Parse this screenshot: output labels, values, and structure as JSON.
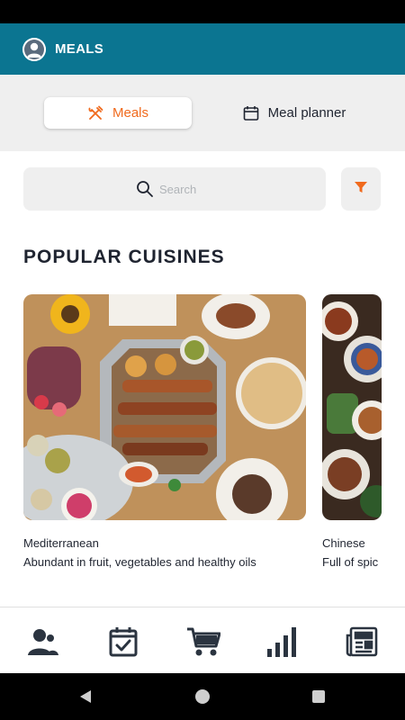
{
  "header": {
    "title": "MEALS",
    "avatar_icon": "user-avatar-icon"
  },
  "tabs": [
    {
      "label": "Meals",
      "icon": "fork-knife-icon",
      "active": true
    },
    {
      "label": "Meal planner",
      "icon": "calendar-icon",
      "active": false
    }
  ],
  "search": {
    "placeholder": "Search",
    "value": ""
  },
  "filter": {
    "icon": "filter-icon"
  },
  "section": {
    "title": "POPULAR CUISINES"
  },
  "cuisines": [
    {
      "name": "Mediterranean",
      "description": "Abundant in fruit, vegetables and healthy oils"
    },
    {
      "name": "Chinese",
      "description": "Full of spic"
    }
  ],
  "bottom_nav": [
    {
      "icon": "profile-icon"
    },
    {
      "icon": "calendar-check-icon"
    },
    {
      "icon": "shopping-cart-icon"
    },
    {
      "icon": "stats-icon"
    },
    {
      "icon": "news-icon"
    }
  ],
  "colors": {
    "header": "#0b7591",
    "accent": "#f06a1d",
    "icon_dark": "#2b3440"
  }
}
